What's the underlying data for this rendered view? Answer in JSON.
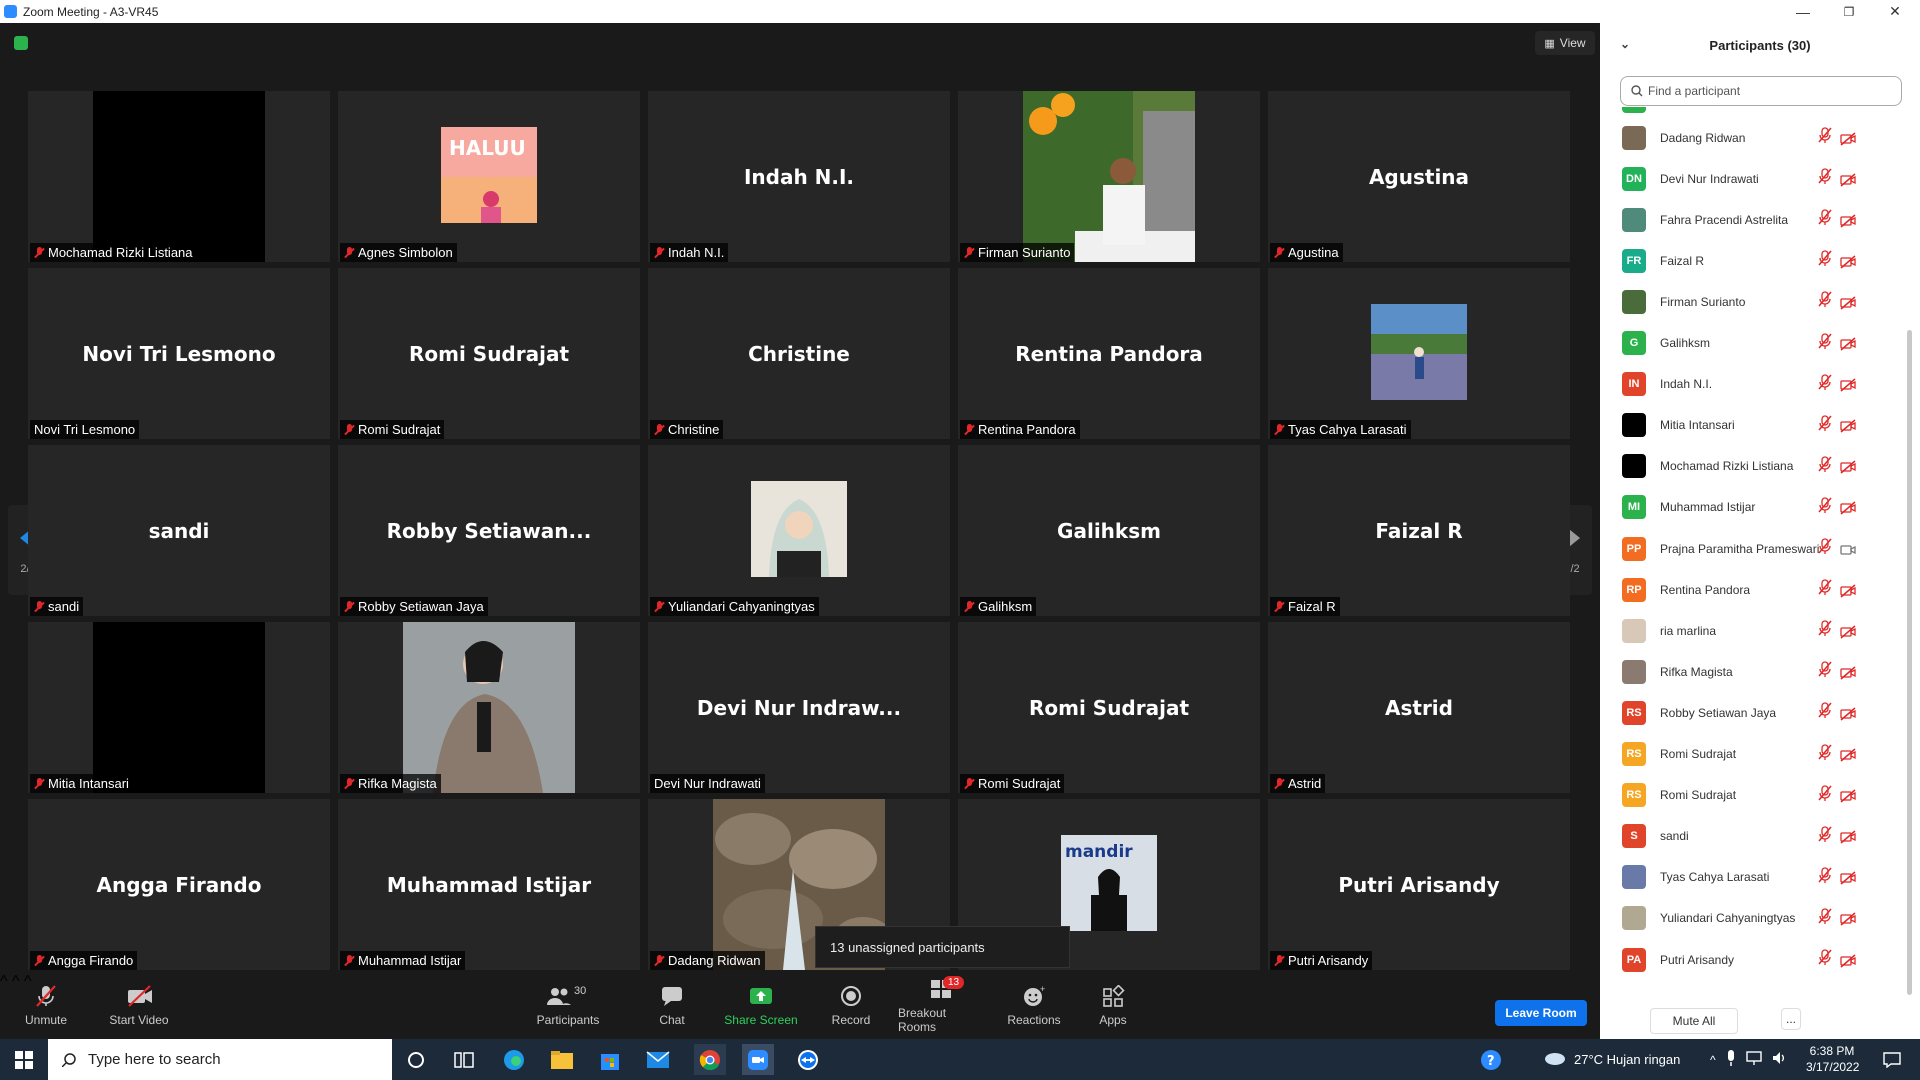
{
  "window": {
    "title": "Zoom Meeting - A3-VR45",
    "min": "—",
    "max": "❐",
    "close": "✕"
  },
  "view_label": "View",
  "pager": {
    "page": "2/2"
  },
  "tiles": [
    {
      "name": "Mochamad Rizki Listiana",
      "big": "",
      "thumb": "black",
      "muted": true
    },
    {
      "name": "Agnes Simbolon",
      "big": "",
      "thumb": "haluu",
      "muted": true
    },
    {
      "name": "Indah N.I.",
      "big": "Indah N.I.",
      "thumb": "",
      "muted": true
    },
    {
      "name": "Firman Surianto",
      "big": "",
      "thumb": "garden",
      "muted": true
    },
    {
      "name": "Agustina",
      "big": "Agustina",
      "thumb": "",
      "muted": true
    },
    {
      "name": "Novi Tri Lesmono",
      "big": "Novi Tri Lesmono",
      "thumb": "",
      "muted": false
    },
    {
      "name": "Romi Sudrajat",
      "big": "Romi Sudrajat",
      "thumb": "",
      "muted": true
    },
    {
      "name": "Christine",
      "big": "Christine",
      "thumb": "",
      "muted": true
    },
    {
      "name": "Rentina Pandora",
      "big": "Rentina Pandora",
      "thumb": "",
      "muted": true
    },
    {
      "name": "Tyas Cahya Larasati",
      "big": "",
      "thumb": "lavender",
      "muted": true
    },
    {
      "name": "sandi",
      "big": "sandi",
      "thumb": "",
      "muted": true
    },
    {
      "name": "Robby Setiawan Jaya",
      "big": "Robby  Setiawan...",
      "thumb": "",
      "muted": true
    },
    {
      "name": "Yuliandari Cahyaningtyas",
      "big": "",
      "thumb": "hijab",
      "muted": true
    },
    {
      "name": "Galihksm",
      "big": "Galihksm",
      "thumb": "",
      "muted": true
    },
    {
      "name": "Faizal R",
      "big": "Faizal R",
      "thumb": "",
      "muted": true
    },
    {
      "name": "Mitia Intansari",
      "big": "",
      "thumb": "black",
      "muted": true
    },
    {
      "name": "Rifka Magista",
      "big": "",
      "thumb": "blazer",
      "muted": true
    },
    {
      "name": "Devi Nur Indrawati",
      "big": "Devi  Nur  Indraw...",
      "thumb": "",
      "muted": false
    },
    {
      "name": "Romi Sudrajat",
      "big": "Romi Sudrajat",
      "thumb": "",
      "muted": true
    },
    {
      "name": "Astrid",
      "big": "Astrid",
      "thumb": "",
      "muted": true
    },
    {
      "name": "Angga Firando",
      "big": "Angga Firando",
      "thumb": "",
      "muted": true
    },
    {
      "name": "Muhammad Istijar",
      "big": "Muhammad Istijar",
      "thumb": "",
      "muted": true
    },
    {
      "name": "Dadang Ridwan",
      "big": "",
      "thumb": "rocks",
      "muted": true
    },
    {
      "name": "",
      "big": "",
      "thumb": "office",
      "muted": false
    },
    {
      "name": "Putri Arisandy",
      "big": "Putri Arisandy",
      "thumb": "",
      "muted": true
    }
  ],
  "tooltip": "13 unassigned participants",
  "toolbar": {
    "unmute": "Unmute",
    "start_video": "Start Video",
    "participants": "Participants",
    "participants_count": "30",
    "chat": "Chat",
    "share_screen": "Share Screen",
    "record": "Record",
    "breakout": "Breakout Rooms",
    "breakout_badge": "13",
    "reactions": "Reactions",
    "apps": "Apps",
    "leave": "Leave Room"
  },
  "panel": {
    "title": "Participants (30)",
    "search_placeholder": "Find a participant",
    "mute_all": "Mute All",
    "more": "...",
    "participants": [
      {
        "name": "Dadang Ridwan",
        "initials": "",
        "color": "#7a6a55",
        "photo": true,
        "cam": "off"
      },
      {
        "name": "Devi Nur Indrawati",
        "initials": "DN",
        "color": "#22b35a",
        "photo": false,
        "cam": "off"
      },
      {
        "name": "Fahra Pracendi Astrelita",
        "initials": "",
        "color": "#4f8a7a",
        "photo": true,
        "cam": "off"
      },
      {
        "name": "Faizal R",
        "initials": "FR",
        "color": "#1aab8a",
        "photo": false,
        "cam": "off"
      },
      {
        "name": "Firman Surianto",
        "initials": "",
        "color": "#4a6b3a",
        "photo": true,
        "cam": "off"
      },
      {
        "name": "Galihksm",
        "initials": "G",
        "color": "#2bb24c",
        "photo": false,
        "cam": "off"
      },
      {
        "name": "Indah N.I.",
        "initials": "IN",
        "color": "#e0452b",
        "photo": false,
        "cam": "off"
      },
      {
        "name": "Mitia Intansari",
        "initials": "",
        "color": "#000000",
        "photo": true,
        "cam": "off"
      },
      {
        "name": "Mochamad Rizki Listiana",
        "initials": "",
        "color": "#000000",
        "photo": true,
        "cam": "off"
      },
      {
        "name": "Muhammad Istijar",
        "initials": "MI",
        "color": "#2bb24c",
        "photo": false,
        "cam": "off"
      },
      {
        "name": "Prajna Paramitha Prameswari",
        "initials": "PP",
        "color": "#f26d21",
        "photo": false,
        "cam": "on"
      },
      {
        "name": "Rentina Pandora",
        "initials": "RP",
        "color": "#f26d21",
        "photo": false,
        "cam": "off"
      },
      {
        "name": "ria marlina",
        "initials": "",
        "color": "#d8c8b8",
        "photo": true,
        "cam": "off"
      },
      {
        "name": "Rifka Magista",
        "initials": "",
        "color": "#8a7a70",
        "photo": true,
        "cam": "off"
      },
      {
        "name": "Robby Setiawan Jaya",
        "initials": "RS",
        "color": "#e0452b",
        "photo": false,
        "cam": "off"
      },
      {
        "name": "Romi Sudrajat",
        "initials": "RS",
        "color": "#f5a623",
        "photo": false,
        "cam": "off"
      },
      {
        "name": "Romi Sudrajat",
        "initials": "RS",
        "color": "#f5a623",
        "photo": false,
        "cam": "off"
      },
      {
        "name": "sandi",
        "initials": "S",
        "color": "#e0452b",
        "photo": false,
        "cam": "off"
      },
      {
        "name": "Tyas Cahya Larasati",
        "initials": "",
        "color": "#6a7aa8",
        "photo": true,
        "cam": "off"
      },
      {
        "name": "Yuliandari Cahyaningtyas",
        "initials": "",
        "color": "#b0a890",
        "photo": true,
        "cam": "off"
      },
      {
        "name": "Putri Arisandy",
        "initials": "PA",
        "color": "#e0452b",
        "photo": false,
        "cam": "off"
      }
    ]
  },
  "taskbar": {
    "search_placeholder": "Type here to search",
    "weather": "27°C  Hujan ringan",
    "time": "6:38 PM",
    "date": "3/17/2022"
  }
}
